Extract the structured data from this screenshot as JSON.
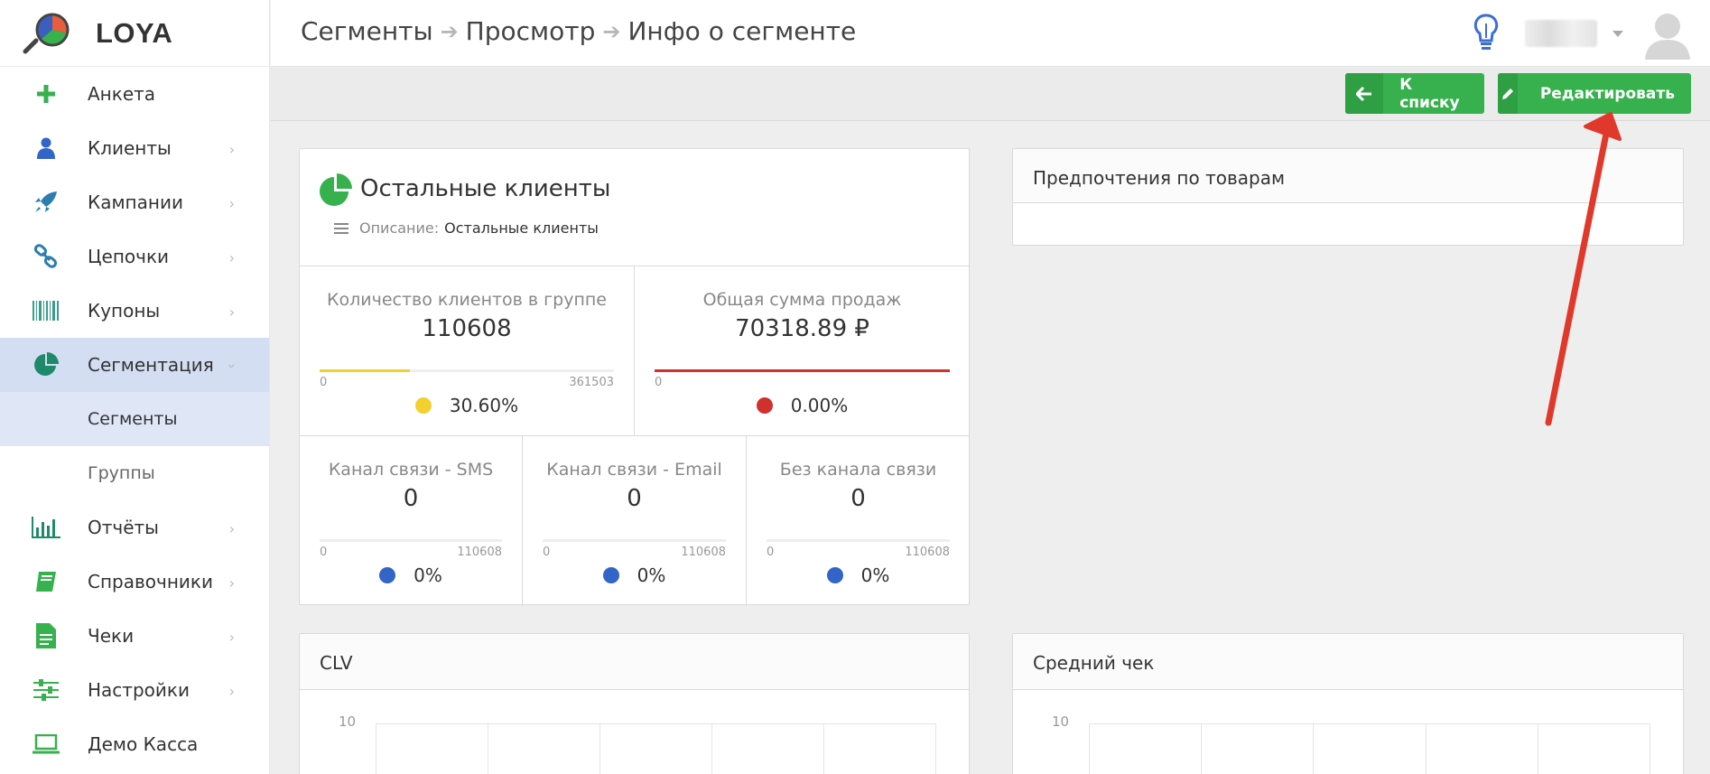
{
  "app": {
    "name": "LOYA"
  },
  "sidebar": {
    "items": [
      {
        "label": "Анкета"
      },
      {
        "label": "Клиенты"
      },
      {
        "label": "Кампании"
      },
      {
        "label": "Цепочки"
      },
      {
        "label": "Купоны"
      },
      {
        "label": "Сегментация"
      },
      {
        "label": "Сегменты"
      },
      {
        "label": "Группы"
      },
      {
        "label": "Отчёты"
      },
      {
        "label": "Справочники"
      },
      {
        "label": "Чеки"
      },
      {
        "label": "Настройки"
      },
      {
        "label": "Демо Касса"
      }
    ]
  },
  "header": {
    "breadcrumbs": [
      "Сегменты",
      "Просмотр",
      "Инфо о сегменте"
    ]
  },
  "toolbar": {
    "back_label": "К списку",
    "edit_label": "Редактировать"
  },
  "segment": {
    "title": "Остальные клиенты",
    "description_label": "Описание:",
    "description_value": "Остальные клиенты",
    "stats": [
      {
        "label": "Количество клиентов в группе",
        "value": "110608",
        "min": "0",
        "max": "361503",
        "percent": "30.60%",
        "fill": 0.306,
        "color": "#f2d12f"
      },
      {
        "label": "Общая сумма продаж",
        "value": "70318.89 ₽",
        "min": "0",
        "percent": "0.00%",
        "fill": 1.0,
        "color": "#d0312d"
      },
      {
        "label": "Канал связи - SMS",
        "value": "0",
        "min": "0",
        "max": "110608",
        "percent": "0%",
        "fill": 0,
        "color": "#3364c7"
      },
      {
        "label": "Канал связи - Email",
        "value": "0",
        "min": "0",
        "max": "110608",
        "percent": "0%",
        "fill": 0,
        "color": "#3364c7"
      },
      {
        "label": "Без канала связи",
        "value": "0",
        "min": "0",
        "max": "110608",
        "percent": "0%",
        "fill": 0,
        "color": "#3364c7"
      }
    ]
  },
  "panels": {
    "preferences_title": "Предпочтения по товарам",
    "clv_title": "CLV",
    "clv_ytick": "10",
    "avg_title": "Средний чек",
    "avg_ytick": "10"
  },
  "colors": {
    "accent_green": "#36b14d",
    "sidebar_active": "#d3def3",
    "annotation_arrow": "#e0392b"
  }
}
